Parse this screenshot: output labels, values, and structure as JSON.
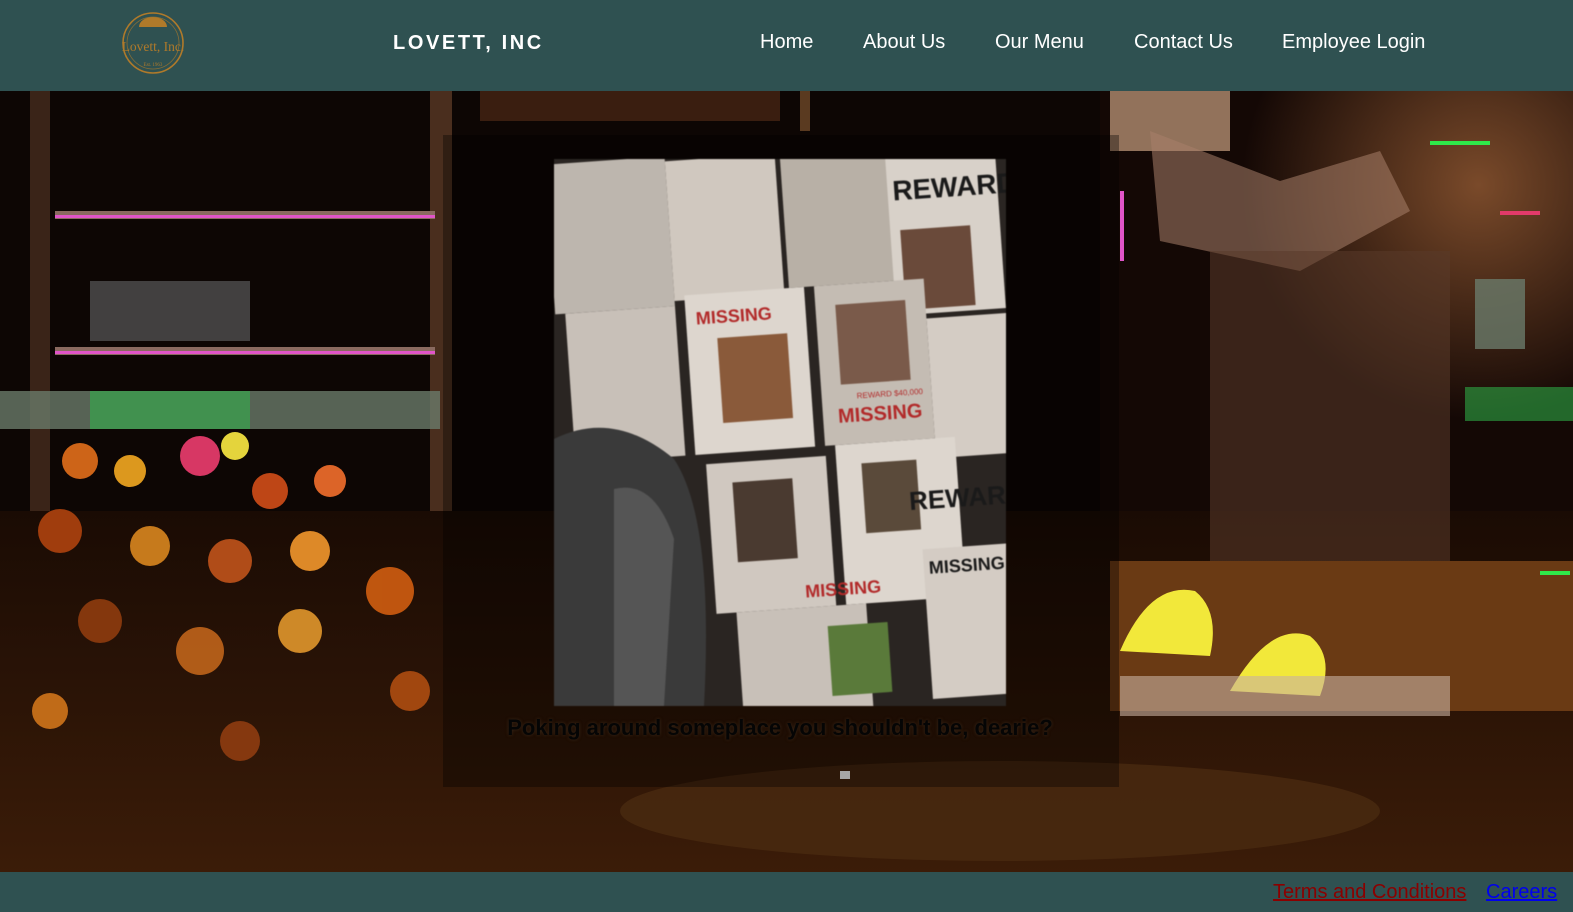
{
  "header": {
    "logo": {
      "icon": "lovett-seal-logo",
      "text": "Lovett, Inc.",
      "sub": "Est. 1963"
    },
    "brand": "LOVETT, INC",
    "nav": [
      {
        "label": "Home"
      },
      {
        "label": "About Us"
      },
      {
        "label": "Our Menu"
      },
      {
        "label": "Contact Us"
      },
      {
        "label": "Employee Login"
      }
    ]
  },
  "hero": {
    "background": "glitched-kitchen-photo",
    "image": "missing-posters-wall",
    "posters": {
      "reward_headline": "REWARD",
      "missing_headline": "MISSING",
      "reward_amount": "REWARD $40,000"
    },
    "message": "Poking around someplace you shouldn't be, dearie?"
  },
  "footer": {
    "terms_label": "Terms and Conditions",
    "careers_label": "Careers"
  },
  "colors": {
    "bar": "#2f5151",
    "nav_text": "#ffffff",
    "terms_link": "#8b0000",
    "careers_link": "#0000ee",
    "logo_gold": "#b07a2a"
  }
}
